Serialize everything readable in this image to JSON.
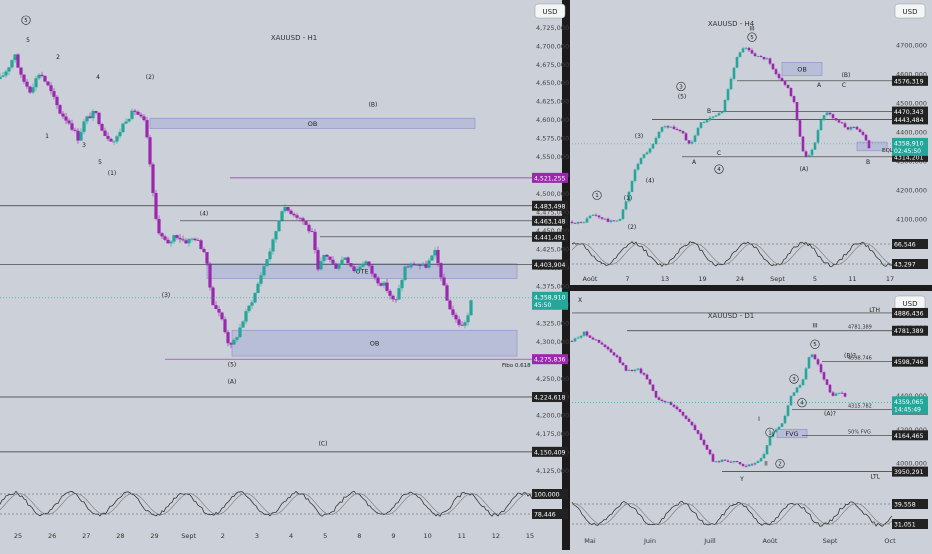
{
  "colors": {
    "background": "#ccd0d8",
    "separator": "#1b1b1b",
    "candle_up": "#26a69a",
    "candle_down": "#9b27af",
    "price_tag": "#26a69a",
    "level_tag": "#222222",
    "purple_tag": "#9b27af",
    "ob_fill": "#a8afd8",
    "oscillator": "#222222"
  },
  "chart_data": [
    {
      "type": "candlestick",
      "symbol": "XAUUSD - H1",
      "currency": "USD",
      "price_axis": [
        "4,750,000",
        "4,725,000",
        "4,700,000",
        "4,675,000",
        "4,650,000",
        "4,625,000",
        "4,600,000",
        "4,575,000",
        "4,550,000",
        "4,525,000",
        "4,500,000",
        "4,475,000",
        "4,450,000",
        "4,425,000",
        "4,400,000",
        "4,375,000",
        "4,350,000",
        "4,325,000",
        "4,300,000",
        "4,275,000",
        "4,250,000",
        "4,225,000",
        "4,200,000",
        "4,175,000",
        "4,150,000",
        "4,125,000"
      ],
      "ylim": [
        4115,
        4762
      ],
      "time_axis": [
        "25",
        "26",
        "27",
        "28",
        "29",
        "Sept",
        "2",
        "3",
        "4",
        "5",
        "8",
        "9",
        "10",
        "11",
        "12",
        "15"
      ],
      "price_path": [
        [
          0,
          4655
        ],
        [
          8,
          4670
        ],
        [
          15,
          4690
        ],
        [
          20,
          4660
        ],
        [
          30,
          4640
        ],
        [
          40,
          4665
        ],
        [
          50,
          4640
        ],
        [
          60,
          4610
        ],
        [
          70,
          4595
        ],
        [
          78,
          4575
        ],
        [
          85,
          4600
        ],
        [
          95,
          4610
        ],
        [
          105,
          4580
        ],
        [
          115,
          4570
        ],
        [
          125,
          4600
        ],
        [
          135,
          4612
        ],
        [
          145,
          4595
        ],
        [
          150,
          4540
        ],
        [
          155,
          4470
        ],
        [
          160,
          4445
        ],
        [
          168,
          4430
        ],
        [
          175,
          4445
        ],
        [
          185,
          4435
        ],
        [
          195,
          4440
        ],
        [
          205,
          4420
        ],
        [
          212,
          4355
        ],
        [
          222,
          4330
        ],
        [
          230,
          4290
        ],
        [
          236,
          4305
        ],
        [
          245,
          4335
        ],
        [
          255,
          4365
        ],
        [
          262,
          4395
        ],
        [
          272,
          4430
        ],
        [
          282,
          4480
        ],
        [
          292,
          4475
        ],
        [
          302,
          4465
        ],
        [
          312,
          4445
        ],
        [
          318,
          4395
        ],
        [
          325,
          4420
        ],
        [
          335,
          4400
        ],
        [
          345,
          4415
        ],
        [
          355,
          4395
        ],
        [
          365,
          4410
        ],
        [
          375,
          4385
        ],
        [
          385,
          4375
        ],
        [
          395,
          4350
        ],
        [
          405,
          4400
        ],
        [
          415,
          4405
        ],
        [
          425,
          4400
        ],
        [
          435,
          4420
        ],
        [
          440,
          4395
        ],
        [
          447,
          4355
        ],
        [
          455,
          4330
        ],
        [
          462,
          4320
        ],
        [
          468,
          4335
        ],
        [
          472,
          4359
        ]
      ],
      "ob_zones": [
        {
          "label": "OB",
          "x": [
            150,
            475
          ],
          "y": [
            4588,
            4602
          ]
        },
        {
          "label": "OTE",
          "x": [
            207,
            517
          ],
          "y": [
            4385,
            4405
          ]
        },
        {
          "label": "OB",
          "x": [
            232,
            517
          ],
          "y": [
            4280,
            4315
          ]
        }
      ],
      "levels": [
        {
          "price": 4521.255,
          "label": "4,521,255",
          "style": "purple",
          "x0": 230
        },
        {
          "price": 4483.498,
          "label": "4,483,498",
          "style": "dark",
          "x0": 0
        },
        {
          "price": 4463.148,
          "label": "4,463,148",
          "style": "dark",
          "x0": 180
        },
        {
          "price": 4441.491,
          "label": "4,441,491",
          "style": "dark",
          "x0": 320
        },
        {
          "price": 4403.904,
          "label": "4,403,904",
          "style": "dark",
          "x0": 0
        },
        {
          "price": 4275.836,
          "label": "4,275,836",
          "style": "purple",
          "x0": 165
        },
        {
          "price": 4224.618,
          "label": "4,224,618",
          "style": "dark",
          "x0": 0
        },
        {
          "price": 4150.409,
          "label": "4,150,409",
          "style": "dark",
          "x0": 0
        }
      ],
      "current_price": {
        "value": 4358.91,
        "label": "4,358,910",
        "countdown": "45:50"
      },
      "fib_label": "Fibo 0.618",
      "wave_labels": [
        {
          "text": "5",
          "x": 26,
          "y": 4732,
          "circled": true
        },
        {
          "text": "5",
          "x": 28,
          "y": 4705
        },
        {
          "text": "2",
          "x": 58,
          "y": 4682
        },
        {
          "text": "4",
          "x": 98,
          "y": 4655
        },
        {
          "text": "1",
          "x": 47,
          "y": 4575
        },
        {
          "text": "3",
          "x": 84,
          "y": 4563
        },
        {
          "text": "5",
          "x": 100,
          "y": 4540
        },
        {
          "text": "(1)",
          "x": 112,
          "y": 4525
        },
        {
          "text": "(2)",
          "x": 150,
          "y": 4655
        },
        {
          "text": "(B)",
          "x": 373,
          "y": 4618
        },
        {
          "text": "(4)",
          "x": 204,
          "y": 4470
        },
        {
          "text": "(3)",
          "x": 166,
          "y": 4360
        },
        {
          "text": "(5)",
          "x": 232,
          "y": 4266
        },
        {
          "text": "(A)",
          "x": 232,
          "y": 4243
        },
        {
          "text": "(C)",
          "x": 323,
          "y": 4159
        }
      ],
      "oscillator": {
        "levels": [
          "100,000",
          "78,446"
        ]
      }
    },
    {
      "type": "candlestick",
      "symbol": "XAUUSD - H4",
      "currency": "USD",
      "price_axis": [
        "4800,000",
        "4700,000",
        "4600,000",
        "4500,000",
        "4400,000",
        "4300,000",
        "4200,000",
        "4100,000",
        "4000,000"
      ],
      "ylim": [
        4055,
        4855
      ],
      "time_axis": [
        "Août",
        "7",
        "13",
        "19",
        "24",
        "Sept",
        "5",
        "11",
        "17"
      ],
      "price_path": [
        [
          0,
          4090
        ],
        [
          10,
          4085
        ],
        [
          20,
          4115
        ],
        [
          28,
          4105
        ],
        [
          38,
          4090
        ],
        [
          48,
          4100
        ],
        [
          55,
          4170
        ],
        [
          62,
          4260
        ],
        [
          68,
          4305
        ],
        [
          78,
          4340
        ],
        [
          90,
          4420
        ],
        [
          100,
          4415
        ],
        [
          110,
          4402
        ],
        [
          115,
          4360
        ],
        [
          120,
          4370
        ],
        [
          128,
          4430
        ],
        [
          140,
          4450
        ],
        [
          150,
          4470
        ],
        [
          158,
          4575
        ],
        [
          165,
          4660
        ],
        [
          172,
          4690
        ],
        [
          178,
          4680
        ],
        [
          185,
          4660
        ],
        [
          195,
          4650
        ],
        [
          205,
          4590
        ],
        [
          215,
          4560
        ],
        [
          222,
          4500
        ],
        [
          230,
          4340
        ],
        [
          236,
          4310
        ],
        [
          242,
          4350
        ],
        [
          248,
          4440
        ],
        [
          255,
          4470
        ],
        [
          265,
          4440
        ],
        [
          275,
          4410
        ],
        [
          282,
          4420
        ],
        [
          290,
          4395
        ],
        [
          298,
          4340
        ]
      ],
      "ob_zones": [
        {
          "label": "OB",
          "x": [
            210,
            250
          ],
          "y": [
            4595,
            4640
          ]
        },
        {
          "label": "",
          "x": [
            285,
            315
          ],
          "y": [
            4335,
            4365
          ]
        }
      ],
      "levels": [
        {
          "price": 4576.319,
          "label": "4576,319",
          "style": "dark",
          "x0": 165
        },
        {
          "price": 4470.343,
          "label": "4470,343",
          "style": "dark",
          "x0": 140
        },
        {
          "price": 4443.484,
          "label": "4443,484",
          "style": "dark",
          "x0": 80
        },
        {
          "price": 4314.201,
          "label": "4314,201",
          "style": "dark",
          "x0": 110
        }
      ],
      "current_price": {
        "value": 4358.91,
        "label": "4358,910",
        "countdown": "02:45:50"
      },
      "eql_label": "EQL",
      "wave_labels": [
        {
          "text": "III",
          "x": 180,
          "y": 4750
        },
        {
          "text": "5",
          "x": 180,
          "y": 4720,
          "circled": true
        },
        {
          "text": "3",
          "x": 109,
          "y": 4550,
          "circled": true
        },
        {
          "text": "(5)",
          "x": 110,
          "y": 4515
        },
        {
          "text": "B",
          "x": 137,
          "y": 4465
        },
        {
          "text": "(B)",
          "x": 274,
          "y": 4590
        },
        {
          "text": "A",
          "x": 247,
          "y": 4555
        },
        {
          "text": "C",
          "x": 272,
          "y": 4555
        },
        {
          "text": "(3)",
          "x": 67,
          "y": 4380
        },
        {
          "text": "(4)",
          "x": 78,
          "y": 4225
        },
        {
          "text": "A",
          "x": 122,
          "y": 4290
        },
        {
          "text": "C",
          "x": 147,
          "y": 4320
        },
        {
          "text": "4",
          "x": 147,
          "y": 4265,
          "circled": true
        },
        {
          "text": "(A)",
          "x": 232,
          "y": 4265
        },
        {
          "text": "B",
          "x": 296,
          "y": 4290
        },
        {
          "text": "1",
          "x": 25,
          "y": 4175,
          "circled": true
        },
        {
          "text": "(1)",
          "x": 56,
          "y": 4165
        },
        {
          "text": "(2)",
          "x": 60,
          "y": 4065
        }
      ],
      "oscillator": {
        "levels": [
          "66,546",
          "43,297"
        ]
      }
    },
    {
      "type": "candlestick",
      "symbol": "XAUUSD - D1",
      "currency": "USD",
      "price_axis": [
        "4800,000",
        "4400,000",
        "4200,000",
        "4000,000"
      ],
      "ylim": [
        3830,
        5010
      ],
      "time_axis": [
        "Mai",
        "Juin",
        "Juill",
        "Août",
        "Sept",
        "Oct"
      ],
      "price_path": [
        [
          0,
          4720
        ],
        [
          12,
          4770
        ],
        [
          22,
          4730
        ],
        [
          32,
          4690
        ],
        [
          45,
          4620
        ],
        [
          55,
          4540
        ],
        [
          65,
          4560
        ],
        [
          75,
          4500
        ],
        [
          85,
          4380
        ],
        [
          95,
          4360
        ],
        [
          105,
          4320
        ],
        [
          115,
          4260
        ],
        [
          125,
          4180
        ],
        [
          135,
          4080
        ],
        [
          142,
          4000
        ],
        [
          150,
          4020
        ],
        [
          160,
          4010
        ],
        [
          170,
          3990
        ],
        [
          180,
          3985
        ],
        [
          190,
          4030
        ],
        [
          200,
          4180
        ],
        [
          210,
          4230
        ],
        [
          220,
          4410
        ],
        [
          230,
          4470
        ],
        [
          238,
          4650
        ],
        [
          245,
          4600
        ],
        [
          252,
          4500
        ],
        [
          260,
          4390
        ],
        [
          268,
          4420
        ],
        [
          275,
          4390
        ]
      ],
      "ob_zones": [
        {
          "label": "FVG",
          "x": [
            205,
            235
          ],
          "y": [
            4150,
            4200
          ]
        }
      ],
      "levels": [
        {
          "price": 4886.436,
          "label": "4886,436",
          "style": "dark",
          "x0": 0,
          "tag": "LTH"
        },
        {
          "price": 4781.389,
          "label": "4781,389",
          "style": "dark",
          "x0": 55,
          "note": "4781.389"
        },
        {
          "price": 4598.746,
          "label": "4598,746",
          "style": "dark",
          "x0": 250,
          "note": "4598.746"
        },
        {
          "price": 4315.782,
          "label": "4315,782",
          "style": "dark",
          "x0": 220,
          "note": "4315.782"
        },
        {
          "price": 4164.465,
          "label": "4164,465",
          "style": "dark",
          "x0": 230,
          "note": "50% FVG"
        },
        {
          "price": 3950.291,
          "label": "3950,291",
          "style": "dark",
          "x0": 150,
          "tag": "LTL"
        }
      ],
      "current_price": {
        "value": 4359.065,
        "label": "4359,065",
        "countdown": "14:45:49"
      },
      "wave_labels": [
        {
          "text": "X",
          "x": 8,
          "y": 4950
        },
        {
          "text": "III",
          "x": 243,
          "y": 4800
        },
        {
          "text": "5",
          "x": 243,
          "y": 4690,
          "circled": true
        },
        {
          "text": "(B)?",
          "x": 278,
          "y": 4625
        },
        {
          "text": "3",
          "x": 222,
          "y": 4485,
          "circled": true
        },
        {
          "text": "4",
          "x": 230,
          "y": 4345,
          "circled": true
        },
        {
          "text": "(A)?",
          "x": 258,
          "y": 4280
        },
        {
          "text": "I",
          "x": 187,
          "y": 4250
        },
        {
          "text": "1",
          "x": 198,
          "y": 4170,
          "circled": true
        },
        {
          "text": "II",
          "x": 194,
          "y": 3985
        },
        {
          "text": "2",
          "x": 208,
          "y": 3985,
          "circled": true
        },
        {
          "text": "Y",
          "x": 170,
          "y": 3895
        }
      ],
      "oscillator": {
        "levels": [
          "39,558",
          "31,051"
        ]
      }
    }
  ]
}
